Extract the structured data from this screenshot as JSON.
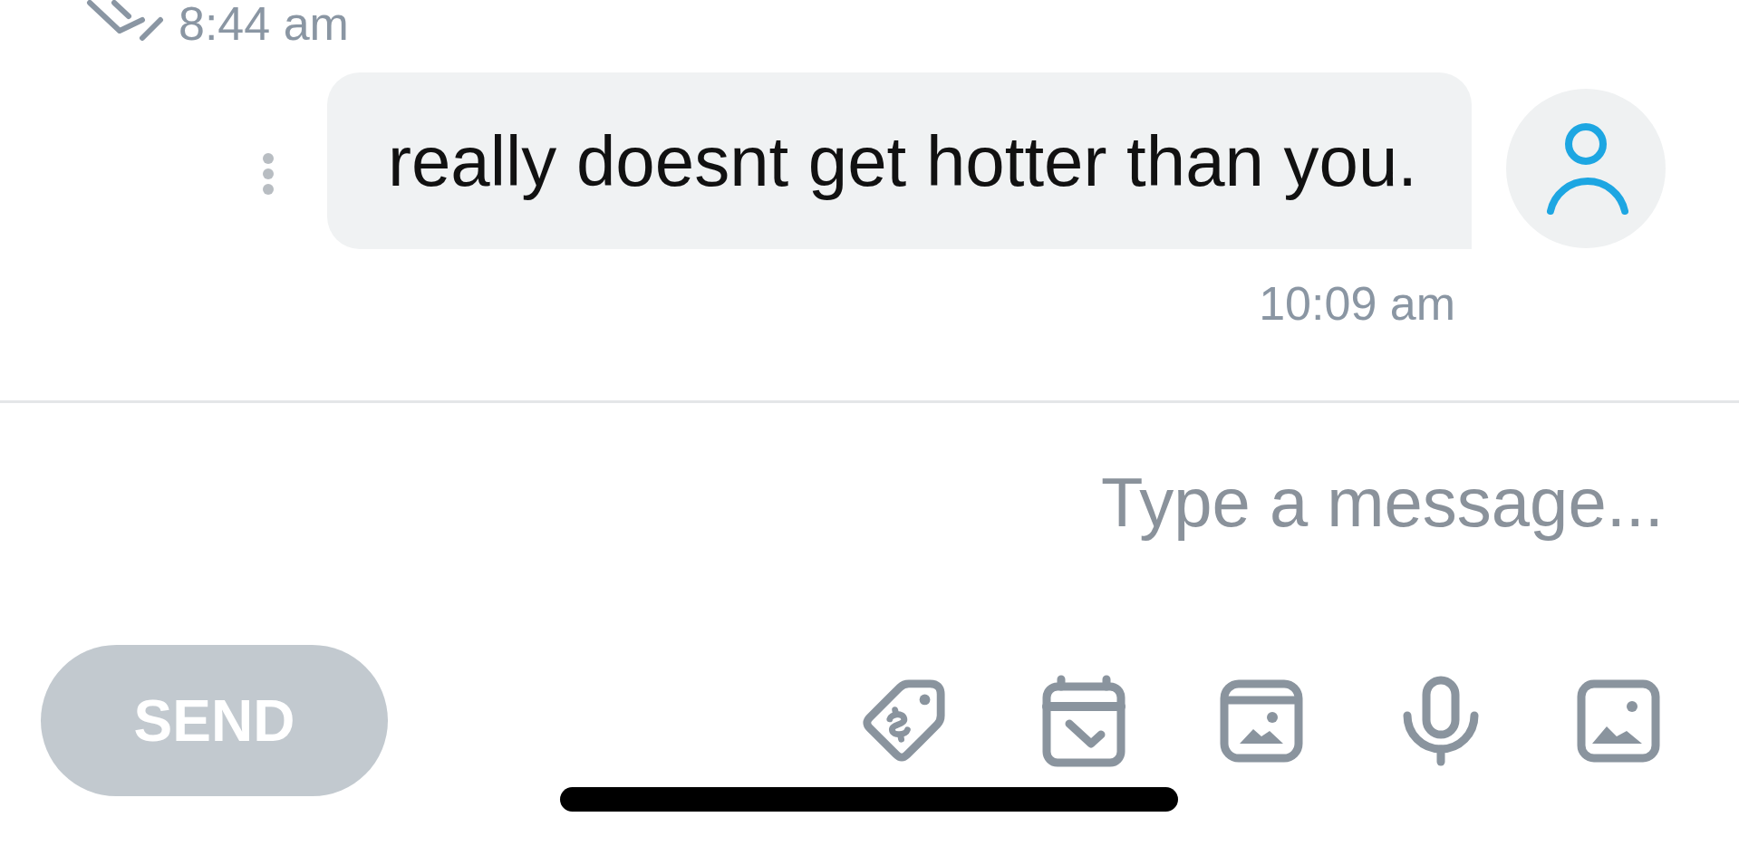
{
  "messages": [
    {
      "kind": "sent",
      "time": "8:44 am"
    },
    {
      "kind": "received",
      "text": "really doesnt get hotter than you.",
      "time": "10:09 am"
    }
  ],
  "composer": {
    "placeholder": "Type a message...",
    "send_button": {
      "label": "SEND",
      "disabled": true
    }
  }
}
